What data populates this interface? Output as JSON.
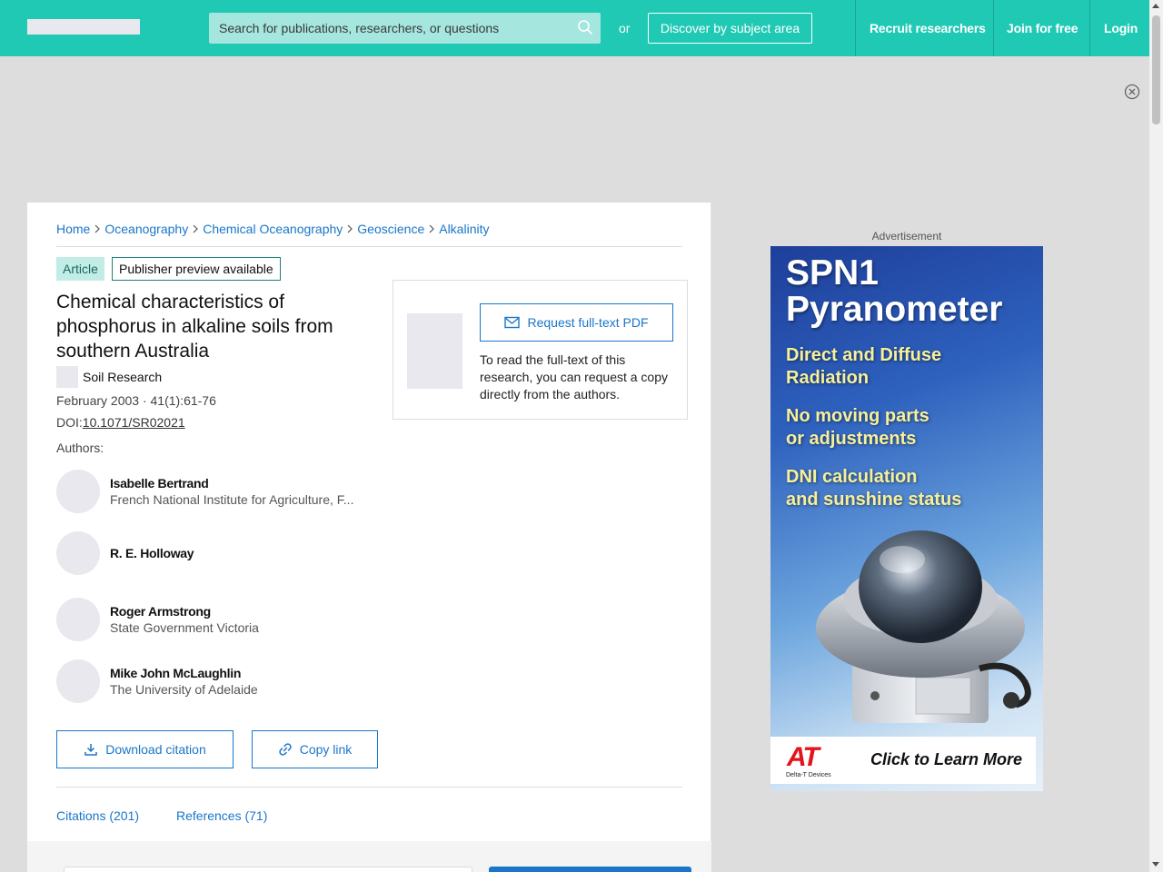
{
  "header": {
    "search_placeholder": "Search for publications, researchers, or questions",
    "or_label": "or",
    "discover_label": "Discover by subject area",
    "nav": [
      "Recruit researchers",
      "Join for free",
      "Login"
    ]
  },
  "breadcrumb": [
    "Home",
    "Oceanography",
    "Chemical Oceanography",
    "Geoscience",
    "Alkalinity"
  ],
  "article": {
    "type_badge": "Article",
    "preview_badge": "Publisher preview available",
    "title": "Chemical characteristics of phosphorus in alkaline soils from southern Australia",
    "journal": "Soil Research",
    "date_volume": "February 2003 · 41(1):61-76",
    "doi_prefix": "DOI:",
    "doi": "10.1071/SR02021",
    "authors_label": "Authors:"
  },
  "authors": [
    {
      "name": "Isabelle Bertrand",
      "affiliation": "French National Institute for Agriculture, F..."
    },
    {
      "name": "R. E. Holloway",
      "affiliation": ""
    },
    {
      "name": "Roger Armstrong",
      "affiliation": "State Government Victoria"
    },
    {
      "name": "Mike John McLaughlin",
      "affiliation": "The University of Adelaide"
    }
  ],
  "actions": {
    "download_citation": "Download citation",
    "copy_link": "Copy link"
  },
  "request": {
    "button": "Request full-text PDF",
    "text": "To read the full-text of this research, you can request a copy directly from the authors."
  },
  "tabs": [
    "Citations (201)",
    "References (71)"
  ],
  "ad": {
    "label": "Advertisement",
    "title_line1": "SPN1",
    "title_line2": "Pyranometer",
    "lines": [
      "Direct and Diffuse",
      "Radiation",
      "No moving parts",
      "or adjustments",
      "DNI calculation",
      "and sunshine status"
    ],
    "logo": "AT",
    "logo_sub": "Delta-T Devices",
    "cta": "Click to Learn More"
  },
  "colors": {
    "brand": "#1fc9b4",
    "link": "#1a76c9"
  }
}
